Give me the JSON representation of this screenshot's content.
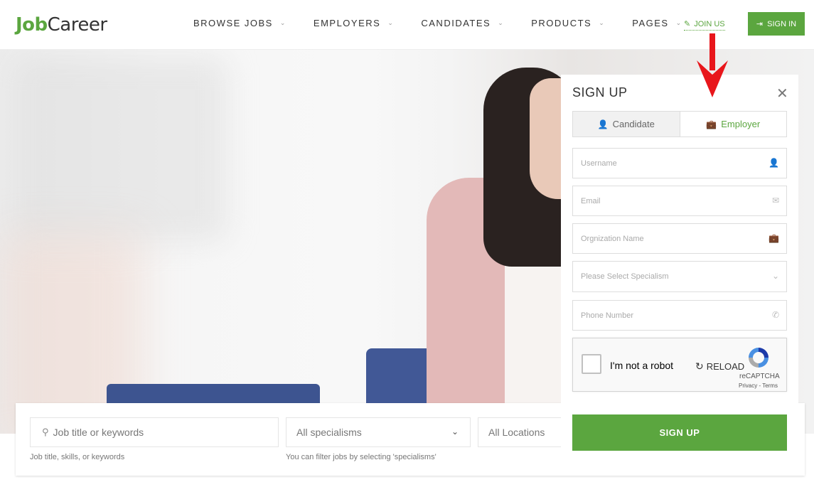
{
  "header": {
    "logo_part1": "Job",
    "logo_part2": "Career",
    "nav": [
      "BROWSE JOBS",
      "EMPLOYERS",
      "CANDIDATES",
      "PRODUCTS",
      "PAGES"
    ],
    "join_label": "JOIN US",
    "signin_label": "SIGN IN"
  },
  "search": {
    "keyword_placeholder": "Job title or keywords",
    "keyword_hint": "Job title, skills, or keywords",
    "specialism_value": "All specialisms",
    "specialism_hint": "You can filter jobs by selecting 'specialisms'",
    "location_value": "All Locations"
  },
  "signup": {
    "title": "SIGN UP",
    "tabs": [
      "Candidate",
      "Employer"
    ],
    "active_tab": "Employer",
    "fields": {
      "username": "Username",
      "email": "Email",
      "organization": "Orgnization Name",
      "specialism": "Please Select Specialism",
      "phone": "Phone Number"
    },
    "recaptcha": {
      "label": "I'm not a robot",
      "reload": "RELOAD",
      "brand": "reCAPTCHA",
      "terms": "Privacy - Terms"
    },
    "submit_label": "SIGN UP"
  },
  "colors": {
    "accent": "#5ba63f",
    "annotation_arrow": "#e8161b"
  }
}
